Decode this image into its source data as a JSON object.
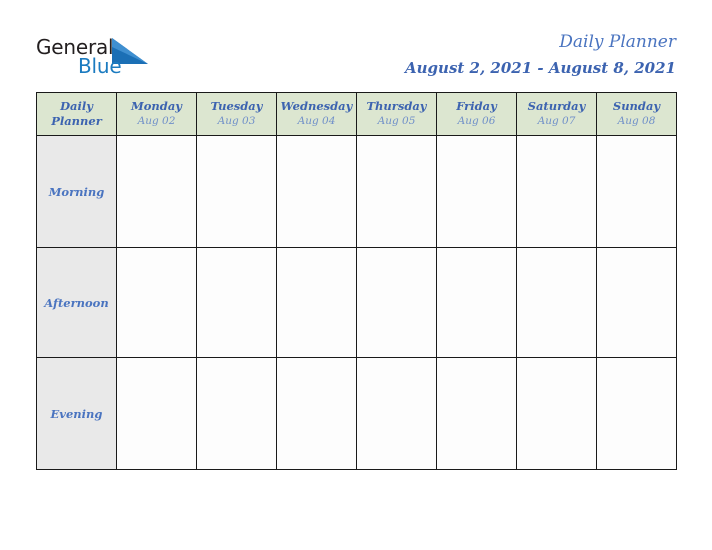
{
  "brand": {
    "word_one": "General",
    "word_two": "Blue",
    "triangle_icon": "triangle-right-icon",
    "color_dark": "#231f20",
    "color_blue": "#1b7bc0"
  },
  "header": {
    "title": "Daily Planner",
    "date_range": "August 2, 2021 - August 8, 2021",
    "title_color": "#4a74c0",
    "range_color": "#3c63b0"
  },
  "table": {
    "corner": {
      "line1": "Daily",
      "line2": "Planner"
    },
    "header_bg": "#dce6d0",
    "row_label_bg": "#e9e9e9",
    "cell_bg": "#fdfdfd",
    "border_color": "#1a1a1a",
    "columns": [
      {
        "day": "Monday",
        "date": "Aug 02"
      },
      {
        "day": "Tuesday",
        "date": "Aug 03"
      },
      {
        "day": "Wednesday",
        "date": "Aug 04"
      },
      {
        "day": "Thursday",
        "date": "Aug 05"
      },
      {
        "day": "Friday",
        "date": "Aug 06"
      },
      {
        "day": "Saturday",
        "date": "Aug 07"
      },
      {
        "day": "Sunday",
        "date": "Aug 08"
      }
    ],
    "rows": [
      {
        "label": "Morning",
        "slots": [
          "",
          "",
          "",
          "",
          "",
          "",
          ""
        ]
      },
      {
        "label": "Afternoon",
        "slots": [
          "",
          "",
          "",
          "",
          "",
          "",
          ""
        ]
      },
      {
        "label": "Evening",
        "slots": [
          "",
          "",
          "",
          "",
          "",
          "",
          ""
        ]
      }
    ]
  }
}
